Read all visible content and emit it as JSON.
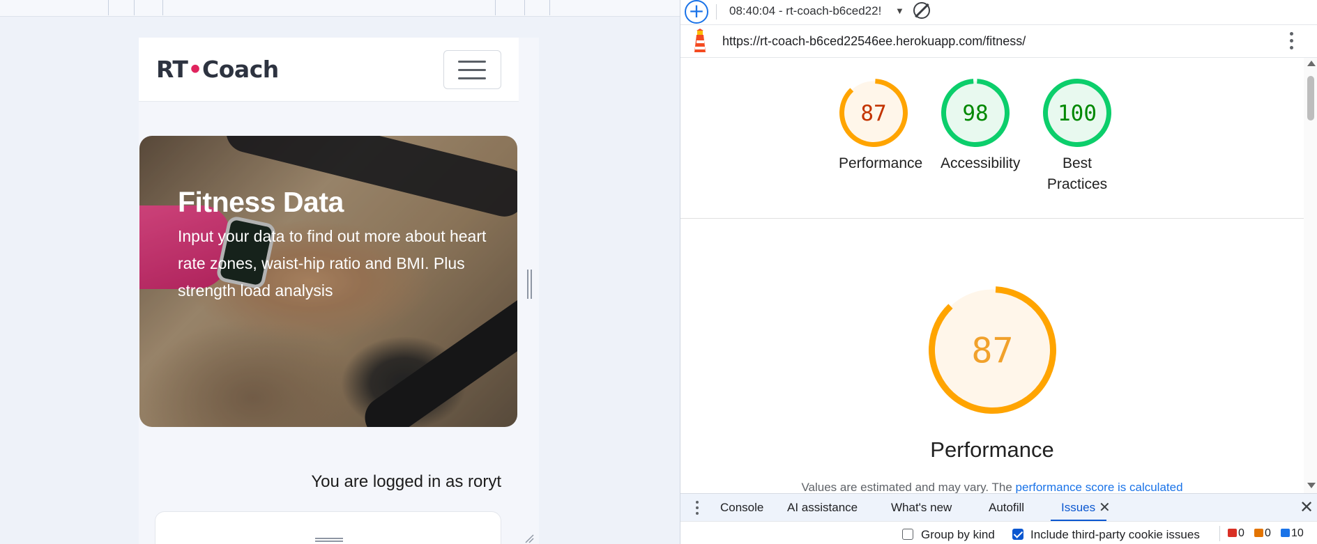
{
  "site": {
    "brand_left": "RT",
    "brand_dot": "•",
    "brand_right": "Coach",
    "hero_title": "Fitness Data",
    "hero_text": "Input your data to find out more about heart rate zones, waist-hip ratio and BMI. Plus strength load analysis",
    "logged_in_text": "You are logged in as roryt"
  },
  "devtools": {
    "report_select": "08:40:04 - rt-coach-b6ced22!",
    "url": "https://rt-coach-b6ced22546ee.herokuapp.com/fitness/",
    "scores": [
      {
        "value": "87",
        "label": "Performance",
        "level": 0.87,
        "color": "#ffa400",
        "bg": "#fff6ea",
        "text_color": "#c33300"
      },
      {
        "value": "98",
        "label": "Accessibility",
        "level": 0.98,
        "color": "#0cce6b",
        "bg": "#e8f9ef",
        "text_color": "#008800"
      },
      {
        "value": "100",
        "label": "Best Practices",
        "level": 1.0,
        "color": "#0cce6b",
        "bg": "#e8f9ef",
        "text_color": "#008800"
      }
    ],
    "big_score": {
      "value": "87",
      "label": "Performance",
      "level": 0.87,
      "color": "#ffa400",
      "bg": "#fff6ea",
      "text_color": "#f1a12b"
    },
    "note_prefix": "Values are estimated and may vary. The ",
    "note_link": "performance score is calculated",
    "drawer_tabs": [
      "Console",
      "AI assistance",
      "What's new",
      "Autofill",
      "Issues"
    ],
    "active_tab": "Issues",
    "group_by_kind": "Group by kind",
    "include_third_party": "Include third-party cookie issues",
    "counts": {
      "errors": "0",
      "warnings": "0",
      "info": "10"
    }
  }
}
